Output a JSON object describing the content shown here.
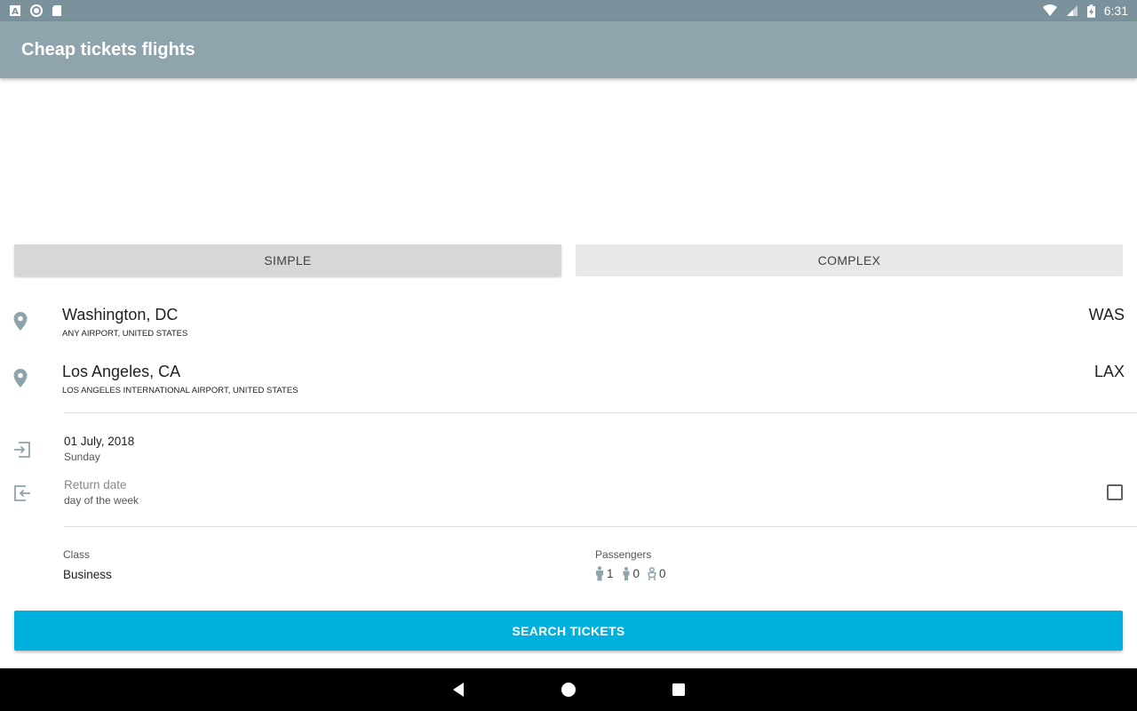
{
  "status_bar": {
    "time": "6:31",
    "left_icons": [
      "keyboard-a-icon",
      "circle-record-icon",
      "sd-card-icon"
    ],
    "right_icons": [
      "wifi-icon",
      "signal-icon",
      "battery-charging-icon"
    ]
  },
  "app_bar": {
    "title": "Cheap tickets flights"
  },
  "mode_tabs": {
    "simple": "SIMPLE",
    "complex": "COMPLEX"
  },
  "origin": {
    "city": "Washington, DC",
    "airport": "ANY AIRPORT, UNITED STATES",
    "code": "WAS"
  },
  "destination": {
    "city": "Los Angeles, CA",
    "airport": "LOS ANGELES INTERNATIONAL AIRPORT, UNITED STATES",
    "code": "LAX"
  },
  "departure": {
    "date": "01 July, 2018",
    "weekday": "Sunday"
  },
  "return": {
    "date": "Return date",
    "weekday": "day of the week",
    "enabled": false
  },
  "travel_class": {
    "label": "Class",
    "value": "Business"
  },
  "passengers": {
    "label": "Passengers",
    "adults": "1",
    "children": "0",
    "infants": "0"
  },
  "search_button": {
    "label": "SEARCH TICKETS"
  },
  "colors": {
    "status_bar": "#7b929c",
    "app_bar": "#90a4ad",
    "accent": "#00b0de",
    "icon_gray": "#8fa3ad"
  }
}
